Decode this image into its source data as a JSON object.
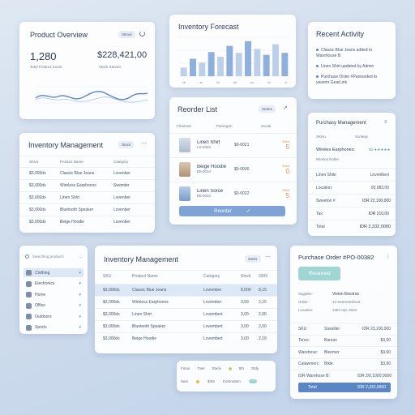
{
  "overview": {
    "title": "Product Overview",
    "badge": "Stimul",
    "count": "1,280",
    "count_label": "Total Product Count",
    "value": "$228,421,00",
    "value_label": "Stack Sannet"
  },
  "forecast": {
    "title": "Inventory Forecast",
    "bars": [
      0.22,
      0.45,
      0.35,
      0.62,
      0.5,
      0.78,
      0.6,
      0.9,
      0.7,
      0.55,
      0.82,
      0.6
    ],
    "x_labels": [
      "bt",
      "st",
      "bt",
      "kh",
      "us",
      "la",
      "iv"
    ]
  },
  "activity": {
    "title": "Recent Activity",
    "items": [
      "Classic Blue Jeans added to Warehouse B",
      "Linen Shirt updated by Admin",
      "Purchase Order #Paresoded to yasemr GearLink"
    ]
  },
  "reorder": {
    "title": "Reorder List",
    "badge": "Seans",
    "headers": [
      "Fnamnet",
      "Parengon",
      "Sociar"
    ],
    "items": [
      {
        "name": "Linen Shirt",
        "sku": "LS-0322",
        "price": "$0-0021",
        "status": "Wish",
        "qty": "5"
      },
      {
        "name": "Beige Hoodie",
        "sku": "B5-0034",
        "price": "$0-0036",
        "status": "Wish",
        "qty": "0"
      },
      {
        "name": "Linen Sorce",
        "sku": "B5-0034",
        "price": "$0-0022",
        "status": "Wish",
        "qty": "5"
      }
    ],
    "button": "Reorder"
  },
  "purchase_small": {
    "title": "Purchasy Management",
    "header_sku": "SKHu",
    "header_right": "Scrlway",
    "product": "Wireles Earphones:",
    "rating": "$3 ★★★★★",
    "sub": "Wireles Noller",
    "rows": [
      {
        "label": "Linen Shile",
        "value": "Lovenlbert"
      },
      {
        "label": "Location:",
        "value": "00,083,00"
      },
      {
        "label": "Sweeton #",
        "value": "IDR 22,100,000"
      },
      {
        "label": "Tax:",
        "value": "IDR 210,00"
      },
      {
        "label": "Total",
        "value": "IDR 2,332,0000"
      }
    ]
  },
  "inv_small": {
    "title": "Inventory Management",
    "badge": "Stock",
    "headers": [
      "SKUs",
      "Product Name",
      "Category"
    ],
    "rows": [
      [
        "$3,000ds",
        "Classic Blue Jeans",
        "Lovenber"
      ],
      [
        "$3,000ds",
        "Wireless Earphones",
        "Swomter"
      ],
      [
        "$3,000ds",
        "Linen Shirt",
        "Lovenber"
      ],
      [
        "$3,000ds",
        "Bluetooth Speaker",
        "Lovenber"
      ],
      [
        "$3,000ds",
        "Beige Hoodie",
        "Lovenber"
      ]
    ]
  },
  "filters": {
    "search": "Searching products",
    "categories": [
      "Clothing",
      "Electronics",
      "Home",
      "Office",
      "Outdoors",
      "Sports"
    ]
  },
  "inv_main": {
    "title": "Inventory Management",
    "badge": "Sstier",
    "headers": [
      "SKU",
      "Product Name",
      "Category",
      "Stock",
      "2006"
    ],
    "rows": [
      [
        "$3,000ds",
        "Classic Blue Jeans",
        "Lovember",
        "8,000",
        "8,15"
      ],
      [
        "$3,000ds",
        "Wireless Earphones",
        "Lovember",
        "3,00",
        "2,15"
      ],
      [
        "$3,000ds",
        "Linen Shirt",
        "Lovembert",
        "3,00",
        "2,90"
      ],
      [
        "$3,000ds",
        "Bluetooth Speaker",
        "Lovembert",
        "3,00",
        "2,00"
      ],
      [
        "$3,000ds",
        "Beige Hoodie",
        "Lovembert",
        "3,00",
        "2,18"
      ]
    ]
  },
  "po": {
    "title": "Purchase Order #PO-00382",
    "status": "Received",
    "supplier_label": "Supplier:",
    "supplier": "Vision Electros",
    "order_label": "Order:",
    "order": "13 Seermenleunt",
    "location_label": "Location:",
    "location": "1384 Apr, 2024",
    "rows": [
      [
        "SKU",
        "Sowoller",
        "IDR 23,100,000"
      ],
      [
        "Toreo:",
        "Banner",
        "$3,90"
      ],
      [
        "Warehose:",
        "Bleomer",
        "$3,90"
      ],
      [
        "Catawmerc:",
        "Bikle",
        "$3,90"
      ]
    ],
    "wh_label": "IDR Warehose B:",
    "wh_value": "IDR 2/0,1000,0000",
    "total_label": "Total",
    "total_value": "IDR 2,332,0000"
  },
  "toolbar": {
    "row1": [
      "Finan",
      "Toiel",
      "Steck",
      "5th",
      "Stdy"
    ],
    "row2": [
      "Seei",
      "$2/6",
      "Commdam"
    ]
  },
  "colors": {
    "accent": "#5b86c4",
    "teal": "#9fd6d3",
    "warn": "#f08a3c",
    "good": "#4caf78"
  }
}
